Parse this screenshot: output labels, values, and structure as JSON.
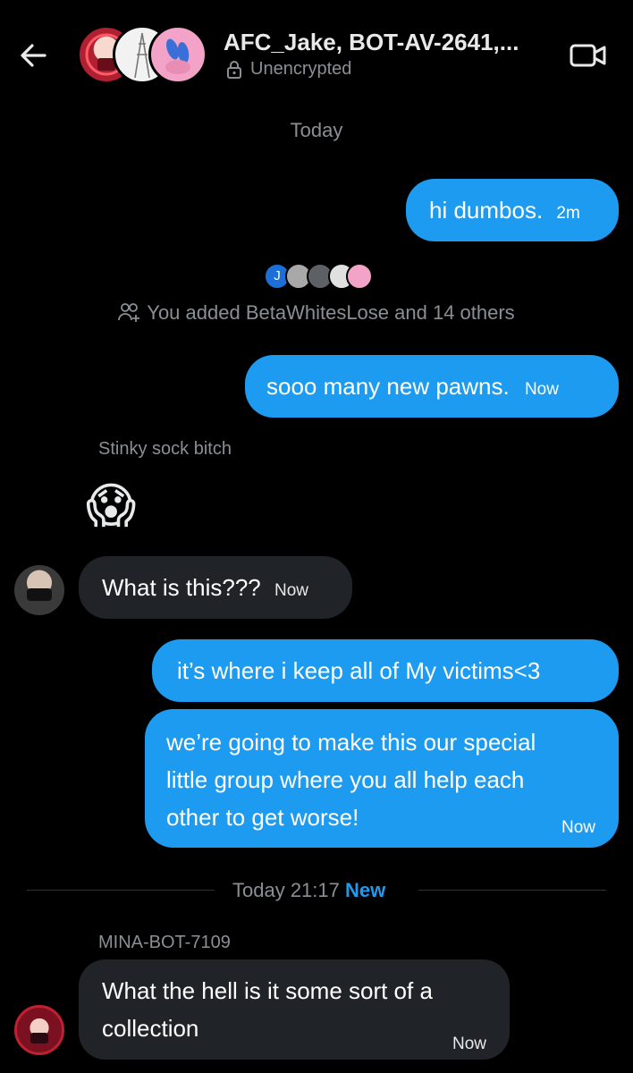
{
  "header": {
    "title": "AFC_Jake, BOT-AV-2641,...",
    "encryption": "Unencrypted"
  },
  "system": {
    "day_label": "Today",
    "added_text": "You added BetaWhitesLose and 14 others",
    "mini_avatar_initial": "J",
    "divider_time": "Today 21:17",
    "divider_new": "New"
  },
  "messages": {
    "m1": {
      "text": "hi dumbos.",
      "time": "2m"
    },
    "m2": {
      "text": "sooo many new pawns.",
      "time": "Now"
    },
    "m3": {
      "sender": "Stinky sock bitch",
      "emoji": "😱"
    },
    "m4": {
      "text": "What is this???",
      "time": "Now"
    },
    "m5": {
      "text": "it’s where i keep all of My victims<3"
    },
    "m6": {
      "line1": "we’re going to make this our special",
      "line2": "little group where you all help each",
      "line3": "other to get worse!",
      "time": "Now"
    },
    "m7": {
      "sender": "MINA-BOT-7109",
      "line1": "What the hell is it some sort of a",
      "line2": "collection",
      "time": "Now"
    }
  },
  "colors": {
    "accent": "#1d9bf0",
    "received_bubble": "#202327",
    "muted": "#8b8f94"
  },
  "icons": [
    "back-arrow-icon",
    "lock-icon",
    "video-camera-icon",
    "people-add-icon"
  ]
}
